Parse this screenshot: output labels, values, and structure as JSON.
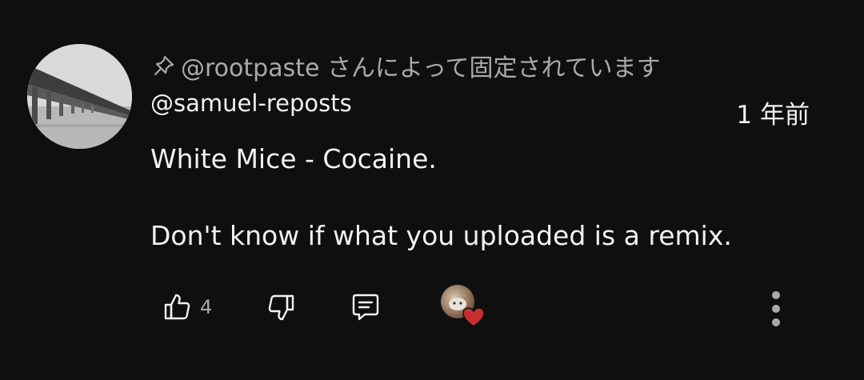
{
  "comment": {
    "pinned_text": "@rootpaste さんによって固定されています",
    "author": "@samuel-reposts",
    "timestamp": "1 年前",
    "body_lines": [
      "White Mice - Cocaine.",
      "Don't know if what you uploaded is a remix."
    ],
    "like_count": "4"
  },
  "icons": {
    "pin": "pin-icon",
    "like": "thumb-up-icon",
    "dislike": "thumb-down-icon",
    "reply": "reply-comment-icon",
    "creator_heart": "heart-icon",
    "more": "more-vertical-icon"
  },
  "colors": {
    "background": "#0f0f0f",
    "primary_text": "#f1f1f1",
    "secondary_text": "#aaaaaa",
    "heart": "#c4302b"
  }
}
